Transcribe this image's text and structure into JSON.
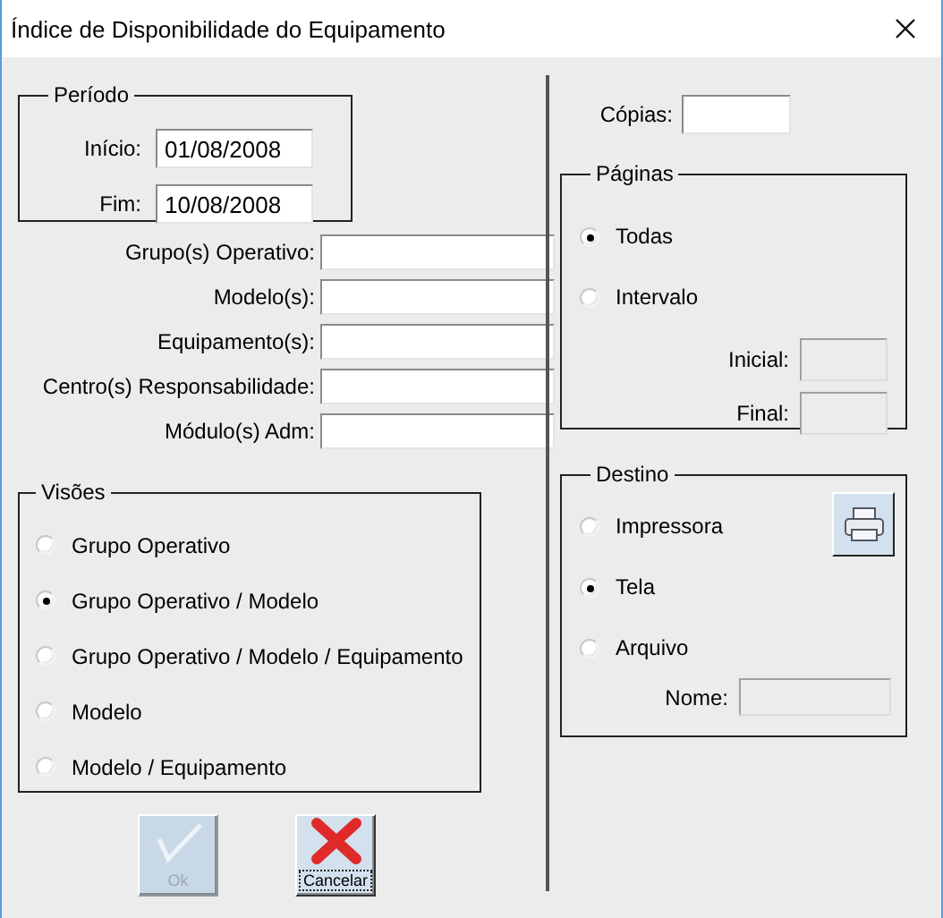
{
  "window": {
    "title": "Índice de Disponibilidade do Equipamento"
  },
  "periodo": {
    "title": "Período",
    "fields": [
      {
        "label": "Início:",
        "value": "01/08/2008"
      },
      {
        "label": "Fim:",
        "value": "10/08/2008"
      }
    ]
  },
  "filters": [
    {
      "label": "Grupo(s) Operativo:"
    },
    {
      "label": "Modelo(s):"
    },
    {
      "label": "Equipamento(s):"
    },
    {
      "label": "Centro(s) Responsabilidade:"
    },
    {
      "label": "Módulo(s) Adm:"
    }
  ],
  "visoes": {
    "title": "Visões",
    "options": [
      {
        "label": "Grupo Operativo",
        "selected": false
      },
      {
        "label": "Grupo Operativo / Modelo",
        "selected": true
      },
      {
        "label": "Grupo Operativo / Modelo / Equipamento",
        "selected": false
      },
      {
        "label": "Modelo",
        "selected": false
      },
      {
        "label": "Modelo / Equipamento",
        "selected": false
      }
    ]
  },
  "buttons": [
    {
      "kind": "ok",
      "label": "Ok",
      "disabled": true
    },
    {
      "kind": "cancel",
      "label": "Cancelar",
      "disabled": false
    }
  ],
  "copias": {
    "label": "Cópias:"
  },
  "paginas": {
    "title": "Páginas",
    "options": [
      {
        "label": "Todas",
        "selected": true
      },
      {
        "label": "Intervalo",
        "selected": false
      }
    ],
    "fields": [
      {
        "label": "Inicial:",
        "disabled": true
      },
      {
        "label": "Final:",
        "disabled": true
      }
    ]
  },
  "destino": {
    "title": "Destino",
    "options": [
      {
        "label": "Impressora",
        "selected": false
      },
      {
        "label": "Tela",
        "selected": true
      },
      {
        "label": "Arquivo",
        "selected": false
      }
    ],
    "fields": [
      {
        "label": "Nome:",
        "disabled": true
      }
    ]
  }
}
